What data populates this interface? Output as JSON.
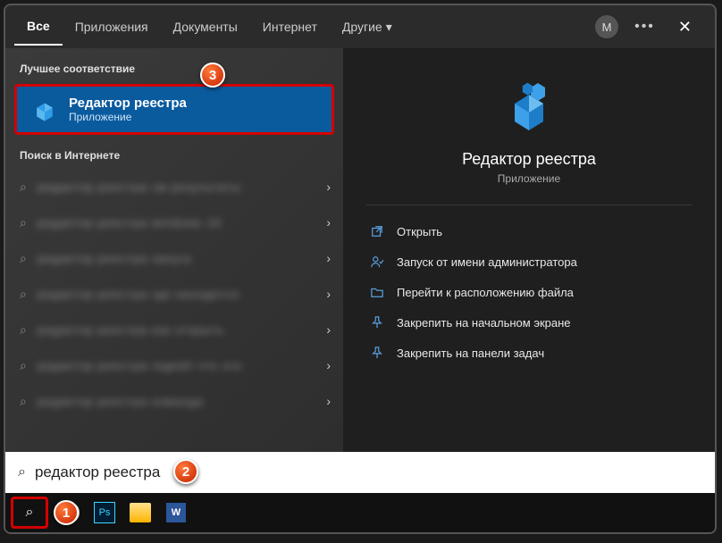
{
  "tabs": {
    "all": "Все",
    "apps": "Приложения",
    "docs": "Документы",
    "internet": "Интернет",
    "other": "Другие"
  },
  "avatar_letter": "M",
  "sections": {
    "best_match": "Лучшее соответствие",
    "web_search": "Поиск в Интернете"
  },
  "best_match": {
    "title": "Редактор реестра",
    "subtitle": "Приложение"
  },
  "preview": {
    "title": "Редактор реестра",
    "subtitle": "Приложение"
  },
  "actions": {
    "open": "Открыть",
    "run_admin": "Запуск от имени администратора",
    "open_location": "Перейти к расположению файла",
    "pin_start": "Закрепить на начальном экране",
    "pin_taskbar": "Закрепить на панели задач"
  },
  "search_value": "редактор реестра",
  "annotations": {
    "a1": "1",
    "a2": "2",
    "a3": "3"
  }
}
